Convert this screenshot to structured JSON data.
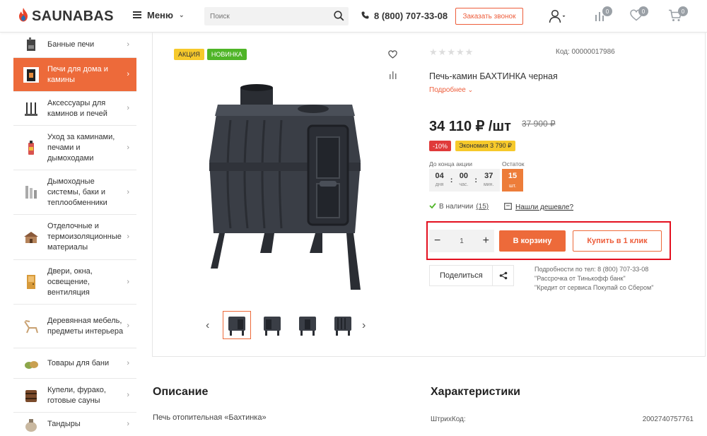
{
  "header": {
    "logo_text": "SAUNABAS",
    "menu_label": "Меню",
    "search_placeholder": "Поиск",
    "phone": "8 (800) 707-33-08",
    "callback_label": "Заказать звонок",
    "compare_count": "0",
    "favorites_count": "0",
    "cart_count": "0"
  },
  "sidebar": {
    "items": [
      {
        "label": "Банные печи"
      },
      {
        "label": "Печи для дома и камины"
      },
      {
        "label": "Аксессуары для каминов и печей"
      },
      {
        "label": "Уход за каминами, печами и дымоходами"
      },
      {
        "label": "Дымоходные системы, баки и теплообменники"
      },
      {
        "label": "Отделочные и термоизоляционные материалы"
      },
      {
        "label": "Двери, окна, освещение, вентиляция"
      },
      {
        "label": "Деревянная мебель, предметы интерьера"
      },
      {
        "label": "Товары для бани"
      },
      {
        "label": "Купели, фурако, готовые сауны"
      },
      {
        "label": "Тандыры"
      }
    ]
  },
  "product": {
    "tag_sale": "АКЦИЯ",
    "tag_new": "НОВИНКА",
    "code": "Код: 00000017986",
    "title": "Печь-камин БАХТИНКА черная",
    "more_label": "Подробнее",
    "price": "34 110 ₽ /шт",
    "old_price": "37 900 ₽",
    "discount": "-10%",
    "economy": "Экономия 3 790 ₽",
    "promo_end_label": "До конца акции",
    "stock_label": "Остаток",
    "timer": {
      "days": "04",
      "days_label": "дня",
      "hours": "00",
      "hours_label": "час.",
      "minutes": "37",
      "minutes_label": "мин."
    },
    "stock_value": "15",
    "stock_unit": "шт.",
    "availability": "В наличии",
    "availability_count": "(15)",
    "cheaper_label": "Нашли дешевле?",
    "quantity": "1",
    "cart_label": "В корзину",
    "one_click_label": "Купить в 1 клик",
    "share_label": "Поделиться",
    "info_lines": [
      "Подробности по тел: 8 (800) 707-33-08",
      "\"Рассрочка от Тинькофф банк\"",
      "\"Кредит от сервиса Покупай со Сбером\""
    ]
  },
  "sections": {
    "description_title": "Описание",
    "description_text": "Печь отопительная «Бахтинка»",
    "specs_title": "Характеристики",
    "spec_barcode_label": "ШтрихКод:",
    "spec_barcode_value": "2002740757761"
  },
  "colors": {
    "accent": "#ed6a3a",
    "highlight_border": "#e3101f",
    "sale_tag": "#f6c92b",
    "new_tag": "#4fb527"
  }
}
